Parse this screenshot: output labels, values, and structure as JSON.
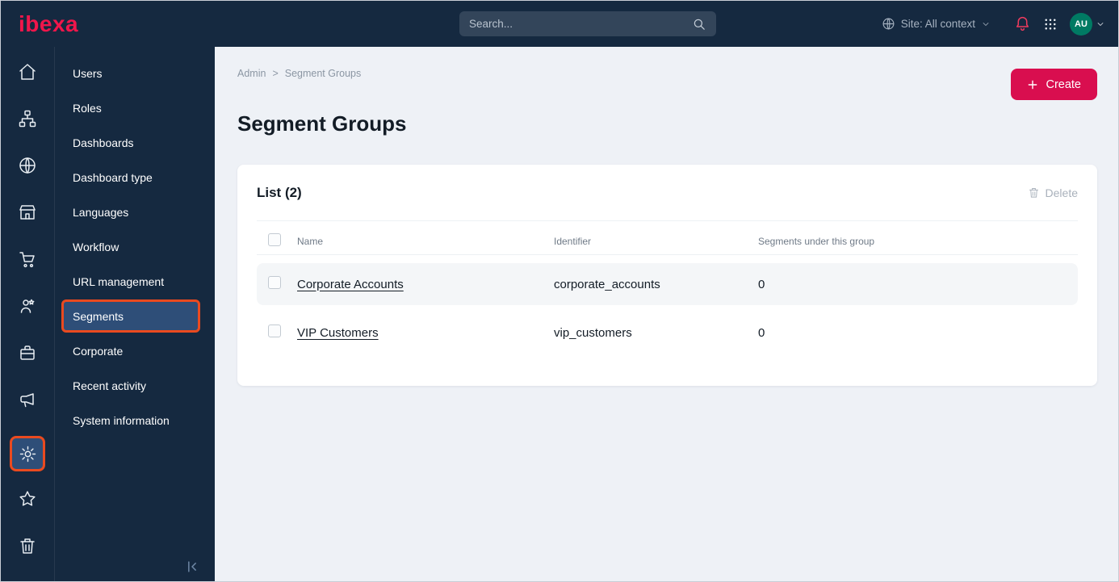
{
  "topbar": {
    "logo": "ibexa",
    "search_placeholder": "Search...",
    "site_context_label": "Site: All context",
    "avatar_initials": "AU"
  },
  "icon_sidebar": {
    "items": [
      "home",
      "content-structure",
      "site",
      "storefront",
      "commerce",
      "customers",
      "products",
      "marketing"
    ],
    "bottom_items": [
      "settings",
      "favorites",
      "trash"
    ],
    "selected": "settings"
  },
  "sidebar": {
    "items": [
      {
        "label": "Users",
        "selected": false
      },
      {
        "label": "Roles",
        "selected": false
      },
      {
        "label": "Dashboards",
        "selected": false
      },
      {
        "label": "Dashboard type",
        "selected": false
      },
      {
        "label": "Languages",
        "selected": false
      },
      {
        "label": "Workflow",
        "selected": false
      },
      {
        "label": "URL management",
        "selected": false
      },
      {
        "label": "Segments",
        "selected": true
      },
      {
        "label": "Corporate",
        "selected": false
      },
      {
        "label": "Recent activity",
        "selected": false
      },
      {
        "label": "System information",
        "selected": false
      }
    ],
    "collapse_icon": "collapse-left"
  },
  "main": {
    "breadcrumb": [
      {
        "label": "Admin"
      },
      {
        "label": "Segment Groups"
      }
    ],
    "breadcrumb_separator": ">",
    "create_button": "Create",
    "page_title": "Segment Groups",
    "list_card": {
      "title": "List (2)",
      "delete_button": "Delete",
      "columns": [
        "Name",
        "Identifier",
        "Segments under this group"
      ],
      "rows": [
        {
          "name": "Corporate Accounts",
          "identifier": "corporate_accounts",
          "segments_count": "0"
        },
        {
          "name": "VIP Customers",
          "identifier": "vip_customers",
          "segments_count": "0"
        }
      ]
    }
  },
  "colors": {
    "topbar_bg": "#152940",
    "accent_pink": "#d90e4f",
    "selected_blue": "#2e4e78",
    "annotation_orange": "#ea4a1f",
    "avatar_teal": "#007a63",
    "main_bg": "#eef1f6"
  }
}
